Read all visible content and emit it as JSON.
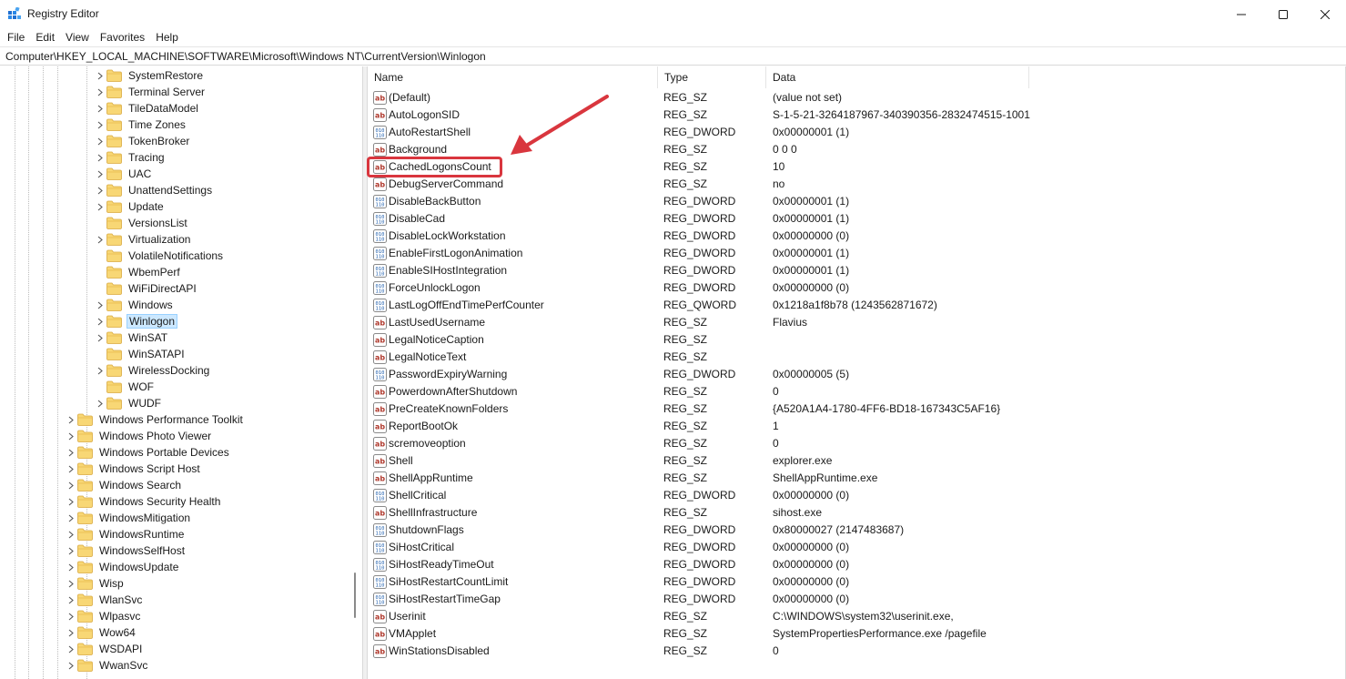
{
  "window": {
    "title": "Registry Editor",
    "controls": {
      "minimize": "minimize-icon",
      "maximize": "maximize-icon",
      "close": "close-icon"
    }
  },
  "menu": [
    "File",
    "Edit",
    "View",
    "Favorites",
    "Help"
  ],
  "address": "Computer\\HKEY_LOCAL_MACHINE\\SOFTWARE\\Microsoft\\Windows NT\\CurrentVersion\\Winlogon",
  "tree": {
    "items": [
      {
        "label": "SystemRestore",
        "level": 2,
        "expandable": true
      },
      {
        "label": "Terminal Server",
        "level": 2,
        "expandable": true
      },
      {
        "label": "TileDataModel",
        "level": 2,
        "expandable": true
      },
      {
        "label": "Time Zones",
        "level": 2,
        "expandable": true
      },
      {
        "label": "TokenBroker",
        "level": 2,
        "expandable": true
      },
      {
        "label": "Tracing",
        "level": 2,
        "expandable": true
      },
      {
        "label": "UAC",
        "level": 2,
        "expandable": true
      },
      {
        "label": "UnattendSettings",
        "level": 2,
        "expandable": true
      },
      {
        "label": "Update",
        "level": 2,
        "expandable": true
      },
      {
        "label": "VersionsList",
        "level": 2,
        "expandable": false
      },
      {
        "label": "Virtualization",
        "level": 2,
        "expandable": true
      },
      {
        "label": "VolatileNotifications",
        "level": 2,
        "expandable": false
      },
      {
        "label": "WbemPerf",
        "level": 2,
        "expandable": false
      },
      {
        "label": "WiFiDirectAPI",
        "level": 2,
        "expandable": false
      },
      {
        "label": "Windows",
        "level": 2,
        "expandable": true
      },
      {
        "label": "Winlogon",
        "level": 2,
        "expandable": true,
        "selected": true
      },
      {
        "label": "WinSAT",
        "level": 2,
        "expandable": true
      },
      {
        "label": "WinSATAPI",
        "level": 2,
        "expandable": false
      },
      {
        "label": "WirelessDocking",
        "level": 2,
        "expandable": true
      },
      {
        "label": "WOF",
        "level": 2,
        "expandable": false
      },
      {
        "label": "WUDF",
        "level": 2,
        "expandable": true
      },
      {
        "label": "Windows Performance Toolkit",
        "level": 1,
        "expandable": true
      },
      {
        "label": "Windows Photo Viewer",
        "level": 1,
        "expandable": true
      },
      {
        "label": "Windows Portable Devices",
        "level": 1,
        "expandable": true
      },
      {
        "label": "Windows Script Host",
        "level": 1,
        "expandable": true
      },
      {
        "label": "Windows Search",
        "level": 1,
        "expandable": true
      },
      {
        "label": "Windows Security Health",
        "level": 1,
        "expandable": true
      },
      {
        "label": "WindowsMitigation",
        "level": 1,
        "expandable": true
      },
      {
        "label": "WindowsRuntime",
        "level": 1,
        "expandable": true
      },
      {
        "label": "WindowsSelfHost",
        "level": 1,
        "expandable": true
      },
      {
        "label": "WindowsUpdate",
        "level": 1,
        "expandable": true
      },
      {
        "label": "Wisp",
        "level": 1,
        "expandable": true
      },
      {
        "label": "WlanSvc",
        "level": 1,
        "expandable": true
      },
      {
        "label": "Wlpasvc",
        "level": 1,
        "expandable": true
      },
      {
        "label": "Wow64",
        "level": 1,
        "expandable": true
      },
      {
        "label": "WSDAPI",
        "level": 1,
        "expandable": true
      },
      {
        "label": "WwanSvc",
        "level": 1,
        "expandable": true
      }
    ]
  },
  "columns": {
    "name": "Name",
    "type": "Type",
    "data": "Data"
  },
  "values": [
    {
      "name": "(Default)",
      "type": "REG_SZ",
      "data": "(value not set)",
      "icon": "string-value-icon"
    },
    {
      "name": "AutoLogonSID",
      "type": "REG_SZ",
      "data": "S-1-5-21-3264187967-340390356-2832474515-1001",
      "icon": "string-value-icon"
    },
    {
      "name": "AutoRestartShell",
      "type": "REG_DWORD",
      "data": "0x00000001 (1)",
      "icon": "binary-value-icon"
    },
    {
      "name": "Background",
      "type": "REG_SZ",
      "data": "0 0 0",
      "icon": "string-value-icon"
    },
    {
      "name": "CachedLogonsCount",
      "type": "REG_SZ",
      "data": "10",
      "icon": "string-value-icon"
    },
    {
      "name": "DebugServerCommand",
      "type": "REG_SZ",
      "data": "no",
      "icon": "string-value-icon"
    },
    {
      "name": "DisableBackButton",
      "type": "REG_DWORD",
      "data": "0x00000001 (1)",
      "icon": "binary-value-icon"
    },
    {
      "name": "DisableCad",
      "type": "REG_DWORD",
      "data": "0x00000001 (1)",
      "icon": "binary-value-icon"
    },
    {
      "name": "DisableLockWorkstation",
      "type": "REG_DWORD",
      "data": "0x00000000 (0)",
      "icon": "binary-value-icon"
    },
    {
      "name": "EnableFirstLogonAnimation",
      "type": "REG_DWORD",
      "data": "0x00000001 (1)",
      "icon": "binary-value-icon"
    },
    {
      "name": "EnableSIHostIntegration",
      "type": "REG_DWORD",
      "data": "0x00000001 (1)",
      "icon": "binary-value-icon"
    },
    {
      "name": "ForceUnlockLogon",
      "type": "REG_DWORD",
      "data": "0x00000000 (0)",
      "icon": "binary-value-icon"
    },
    {
      "name": "LastLogOffEndTimePerfCounter",
      "type": "REG_QWORD",
      "data": "0x1218a1f8b78 (1243562871672)",
      "icon": "binary-value-icon"
    },
    {
      "name": "LastUsedUsername",
      "type": "REG_SZ",
      "data": "Flavius",
      "icon": "string-value-icon"
    },
    {
      "name": "LegalNoticeCaption",
      "type": "REG_SZ",
      "data": "",
      "icon": "string-value-icon"
    },
    {
      "name": "LegalNoticeText",
      "type": "REG_SZ",
      "data": "",
      "icon": "string-value-icon"
    },
    {
      "name": "PasswordExpiryWarning",
      "type": "REG_DWORD",
      "data": "0x00000005 (5)",
      "icon": "binary-value-icon"
    },
    {
      "name": "PowerdownAfterShutdown",
      "type": "REG_SZ",
      "data": "0",
      "icon": "string-value-icon"
    },
    {
      "name": "PreCreateKnownFolders",
      "type": "REG_SZ",
      "data": "{A520A1A4-1780-4FF6-BD18-167343C5AF16}",
      "icon": "string-value-icon"
    },
    {
      "name": "ReportBootOk",
      "type": "REG_SZ",
      "data": "1",
      "icon": "string-value-icon"
    },
    {
      "name": "scremoveoption",
      "type": "REG_SZ",
      "data": "0",
      "icon": "string-value-icon"
    },
    {
      "name": "Shell",
      "type": "REG_SZ",
      "data": "explorer.exe",
      "icon": "string-value-icon"
    },
    {
      "name": "ShellAppRuntime",
      "type": "REG_SZ",
      "data": "ShellAppRuntime.exe",
      "icon": "string-value-icon"
    },
    {
      "name": "ShellCritical",
      "type": "REG_DWORD",
      "data": "0x00000000 (0)",
      "icon": "binary-value-icon"
    },
    {
      "name": "ShellInfrastructure",
      "type": "REG_SZ",
      "data": "sihost.exe",
      "icon": "string-value-icon"
    },
    {
      "name": "ShutdownFlags",
      "type": "REG_DWORD",
      "data": "0x80000027 (2147483687)",
      "icon": "binary-value-icon"
    },
    {
      "name": "SiHostCritical",
      "type": "REG_DWORD",
      "data": "0x00000000 (0)",
      "icon": "binary-value-icon"
    },
    {
      "name": "SiHostReadyTimeOut",
      "type": "REG_DWORD",
      "data": "0x00000000 (0)",
      "icon": "binary-value-icon"
    },
    {
      "name": "SiHostRestartCountLimit",
      "type": "REG_DWORD",
      "data": "0x00000000 (0)",
      "icon": "binary-value-icon"
    },
    {
      "name": "SiHostRestartTimeGap",
      "type": "REG_DWORD",
      "data": "0x00000000 (0)",
      "icon": "binary-value-icon"
    },
    {
      "name": "Userinit",
      "type": "REG_SZ",
      "data": "C:\\WINDOWS\\system32\\userinit.exe,",
      "icon": "string-value-icon"
    },
    {
      "name": "VMApplet",
      "type": "REG_SZ",
      "data": "SystemPropertiesPerformance.exe /pagefile",
      "icon": "string-value-icon"
    },
    {
      "name": "WinStationsDisabled",
      "type": "REG_SZ",
      "data": "0",
      "icon": "string-value-icon"
    }
  ],
  "annotation": {
    "highlighted_value": "CachedLogonsCount",
    "color": "#d9363e"
  },
  "colors": {
    "folder": "#f8d775",
    "selection": "#cce8ff",
    "accent": "#0067c0"
  }
}
